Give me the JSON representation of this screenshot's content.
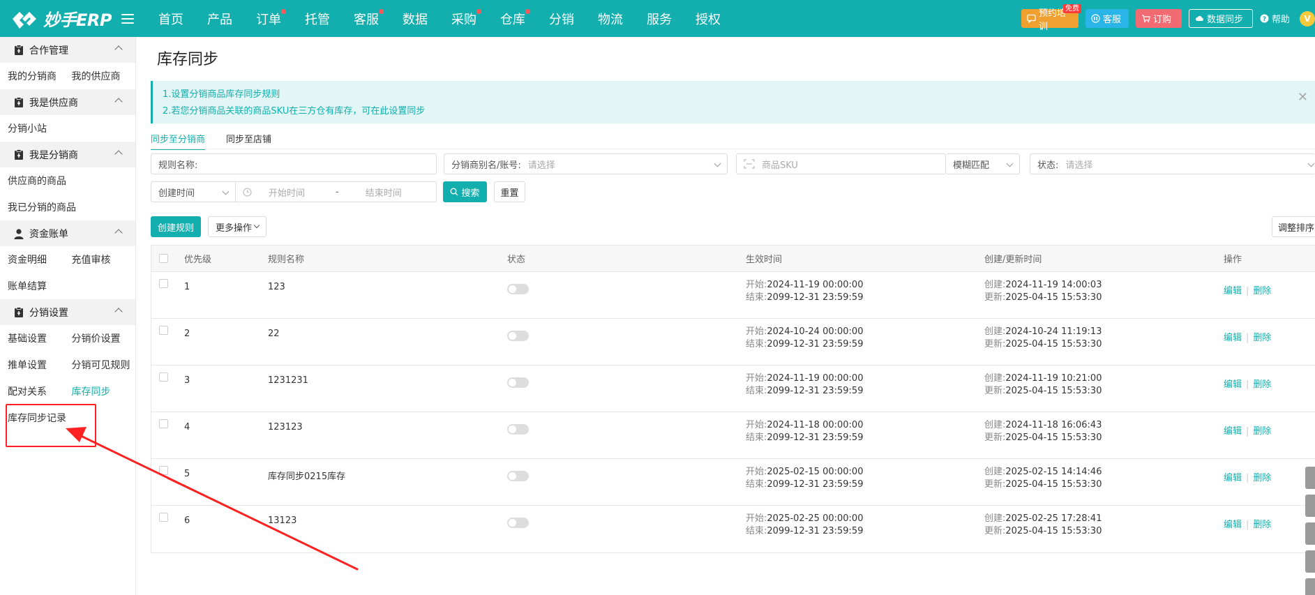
{
  "app": {
    "logo_text": "妙手ERP"
  },
  "topnav": [
    {
      "label": "首页",
      "dot": false
    },
    {
      "label": "产品",
      "dot": false
    },
    {
      "label": "订单",
      "dot": true
    },
    {
      "label": "托管",
      "dot": false
    },
    {
      "label": "客服",
      "dot": true
    },
    {
      "label": "数据",
      "dot": false
    },
    {
      "label": "采购",
      "dot": true
    },
    {
      "label": "仓库",
      "dot": true
    },
    {
      "label": "分销",
      "dot": false
    },
    {
      "label": "物流",
      "dot": false
    },
    {
      "label": "服务",
      "dot": false
    },
    {
      "label": "授权",
      "dot": false
    }
  ],
  "top_actions": {
    "training": "预约培训",
    "free_badge": "免费",
    "service": "客服",
    "order": "订购",
    "data_sync": "数据同步",
    "help": "帮助",
    "vip": "V"
  },
  "sidebar": {
    "sections": [
      {
        "title": "合作管理",
        "icon": "clipboard-icon",
        "rows": [
          [
            {
              "label": "我的分销商"
            },
            {
              "label": "我的供应商"
            }
          ]
        ]
      },
      {
        "title": "我是供应商",
        "icon": "clipboard-icon",
        "rows": [
          [
            {
              "label": "分销小站"
            }
          ]
        ]
      },
      {
        "title": "我是分销商",
        "icon": "clipboard-icon",
        "rows": [
          [
            {
              "label": "供应商的商品"
            }
          ],
          [
            {
              "label": "我已分销的商品"
            }
          ]
        ]
      },
      {
        "title": "资金账单",
        "icon": "user-icon",
        "rows": [
          [
            {
              "label": "资金明细"
            },
            {
              "label": "充值审核"
            }
          ],
          [
            {
              "label": "账单结算"
            }
          ]
        ]
      },
      {
        "title": "分销设置",
        "icon": "clipboard-icon",
        "rows": [
          [
            {
              "label": "基础设置"
            },
            {
              "label": "分销价设置"
            }
          ],
          [
            {
              "label": "推单设置"
            },
            {
              "label": "分销可见规则"
            }
          ],
          [
            {
              "label": "配对关系"
            },
            {
              "label": "库存同步",
              "active": true
            }
          ],
          [
            {
              "label": "库存同步记录"
            }
          ]
        ]
      }
    ]
  },
  "page": {
    "title": "库存同步",
    "notice_lines": [
      "1.设置分销商品库存同步规则",
      "2.若您分销商品关联的商品SKU在三方仓有库存，可在此设置同步"
    ],
    "tabs": [
      "同步至分销商",
      "同步至店铺"
    ]
  },
  "filters": {
    "rule_name_label": "规则名称:",
    "distributor_label": "分销商别名/账号:",
    "distributor_placeholder": "请选择",
    "sku_placeholder": "商品SKU",
    "match_mode": "模糊匹配",
    "status_label": "状态:",
    "status_placeholder": "请选择",
    "time_type": "创建时间",
    "start_placeholder": "开始时间",
    "range_sep": "-",
    "end_placeholder": "结束时间",
    "search_label": "搜索",
    "reset_label": "重置"
  },
  "toolbar": {
    "create_label": "创建规则",
    "more_label": "更多操作",
    "adjust_label": "调整排序"
  },
  "table": {
    "headers": {
      "priority": "优先级",
      "name": "规则名称",
      "status": "状态",
      "effective": "生效时间",
      "created": "创建/更新时间",
      "ops": "操作"
    },
    "labels": {
      "start": "开始:",
      "end": "结束:",
      "create": "创建:",
      "update": "更新:",
      "edit": "编辑",
      "delete": "删除"
    },
    "rows": [
      {
        "priority": "1",
        "name": "123",
        "enabled": false,
        "start": "2024-11-19 00:00:00",
        "end": "2099-12-31 23:59:59",
        "created": "2024-11-19 14:00:03",
        "updated": "2025-04-15 15:53:30"
      },
      {
        "priority": "2",
        "name": "22",
        "enabled": false,
        "start": "2024-10-24 00:00:00",
        "end": "2099-12-31 23:59:59",
        "created": "2024-10-24 11:19:13",
        "updated": "2025-04-15 15:53:30"
      },
      {
        "priority": "3",
        "name": "1231231",
        "enabled": false,
        "start": "2024-11-19 00:00:00",
        "end": "2099-12-31 23:59:59",
        "created": "2024-11-19 10:21:00",
        "updated": "2025-04-15 15:53:30"
      },
      {
        "priority": "4",
        "name": "123123",
        "enabled": false,
        "start": "2024-11-18 00:00:00",
        "end": "2099-12-31 23:59:59",
        "created": "2024-11-18 16:06:43",
        "updated": "2025-04-15 15:53:30"
      },
      {
        "priority": "5",
        "name": "库存同步0215库存",
        "enabled": false,
        "start": "2025-02-15 00:00:00",
        "end": "2099-12-31 23:59:59",
        "created": "2025-02-15 14:14:46",
        "updated": "2025-04-15 15:53:30"
      },
      {
        "priority": "6",
        "name": "13123",
        "enabled": false,
        "start": "2025-02-25 00:00:00",
        "end": "2099-12-31 23:59:59",
        "created": "2025-02-25 17:28:41",
        "updated": "2025-04-15 15:53:30"
      }
    ]
  },
  "colors": {
    "brand": "#13aeae",
    "annotation": "#ff2222"
  }
}
